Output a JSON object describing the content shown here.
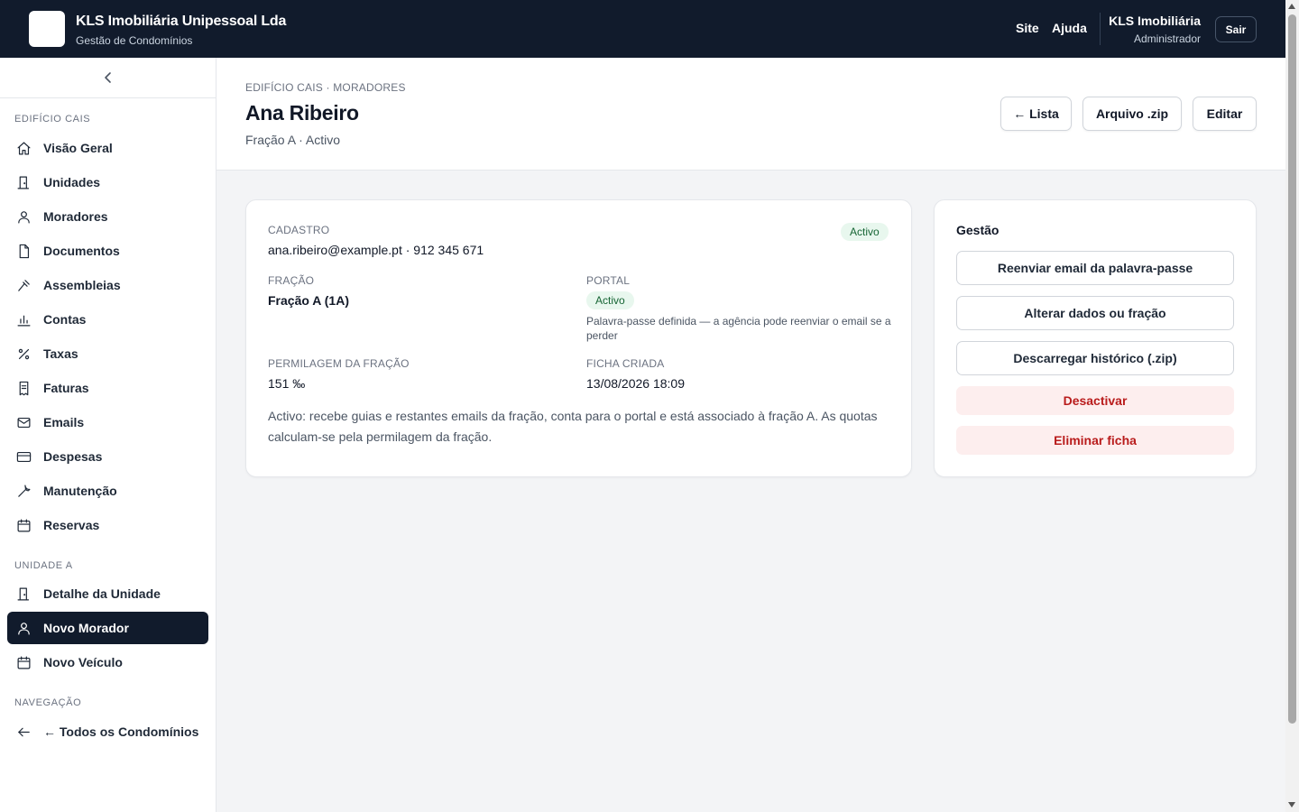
{
  "topbar": {
    "company": "KLS Imobiliária Unipessoal Lda",
    "subtitle": "Gestão de Condomínios",
    "links": [
      "Site",
      "Ajuda"
    ],
    "user_name": "KLS Imobiliária",
    "user_role": "Administrador",
    "logout_label": "Sair"
  },
  "sidebar": {
    "section_building": "EDIFÍCIO CAIS",
    "building_items": [
      {
        "label": "Visão Geral",
        "icon": "home-icon"
      },
      {
        "label": "Unidades",
        "icon": "building-icon"
      },
      {
        "label": "Moradores",
        "icon": "user-icon"
      },
      {
        "label": "Documentos",
        "icon": "document-icon"
      },
      {
        "label": "Assembleias",
        "icon": "gavel-icon"
      },
      {
        "label": "Contas",
        "icon": "bar-chart-icon"
      },
      {
        "label": "Taxas",
        "icon": "percent-icon"
      },
      {
        "label": "Faturas",
        "icon": "receipt-icon"
      },
      {
        "label": "Emails",
        "icon": "mail-icon"
      },
      {
        "label": "Despesas",
        "icon": "credit-card-icon"
      },
      {
        "label": "Manutenção",
        "icon": "wrench-icon"
      },
      {
        "label": "Reservas",
        "icon": "calendar-icon"
      }
    ],
    "section_unit": "UNIDADE A",
    "unit_items": [
      {
        "label": "Detalhe da Unidade",
        "icon": "building-icon"
      },
      {
        "label": "Novo Morador",
        "icon": "user-icon",
        "active": true
      },
      {
        "label": "Novo Veículo",
        "icon": "calendar-icon"
      }
    ],
    "section_nav": "NAVEGAÇÃO",
    "nav_item": {
      "label": "← Todos os Condomínios",
      "icon": "arrow-left-icon"
    }
  },
  "header": {
    "breadcrumb": "EDIFÍCIO CAIS · MORADORES",
    "title": "Ana Ribeiro",
    "subtitle": "Fração A · Activo",
    "buttons": [
      "← Lista",
      "Arquivo .zip",
      "Editar"
    ]
  },
  "details": {
    "cadastro_label": "CADASTRO",
    "contact": "ana.ribeiro@example.pt · 912 345 671",
    "status_badge": "Activo",
    "fracao_label": "FRAÇÃO",
    "fracao_value": "Fração A (1A)",
    "portal_label": "PORTAL",
    "portal_badge": "Activo",
    "portal_note": "Palavra-passe definida — a agência pode reenviar o email se a perder",
    "permilagem_label": "PERMILAGEM DA FRAÇÃO",
    "permilagem_value": "151 ‰",
    "ficha_label": "FICHA CRIADA",
    "ficha_value": "13/08/2026 18:09",
    "description": "Activo: recebe guias e restantes emails da fração, conta para o portal e está associado à fração A. As quotas calculam-se pela permilagem da fração."
  },
  "gestao": {
    "title": "Gestão",
    "actions": [
      "Reenviar email da palavra-passe",
      "Alterar dados ou fração",
      "Descarregar histórico (.zip)"
    ],
    "danger_actions": [
      "Desactivar",
      "Eliminar ficha"
    ]
  },
  "colors": {
    "topbar_bg": "#111b2c",
    "active_nav_bg": "#111b2c",
    "badge_green_bg": "#e8f7ee",
    "badge_green_text": "#166534",
    "danger_bg": "#fdeeee",
    "danger_text": "#b91c1c"
  }
}
